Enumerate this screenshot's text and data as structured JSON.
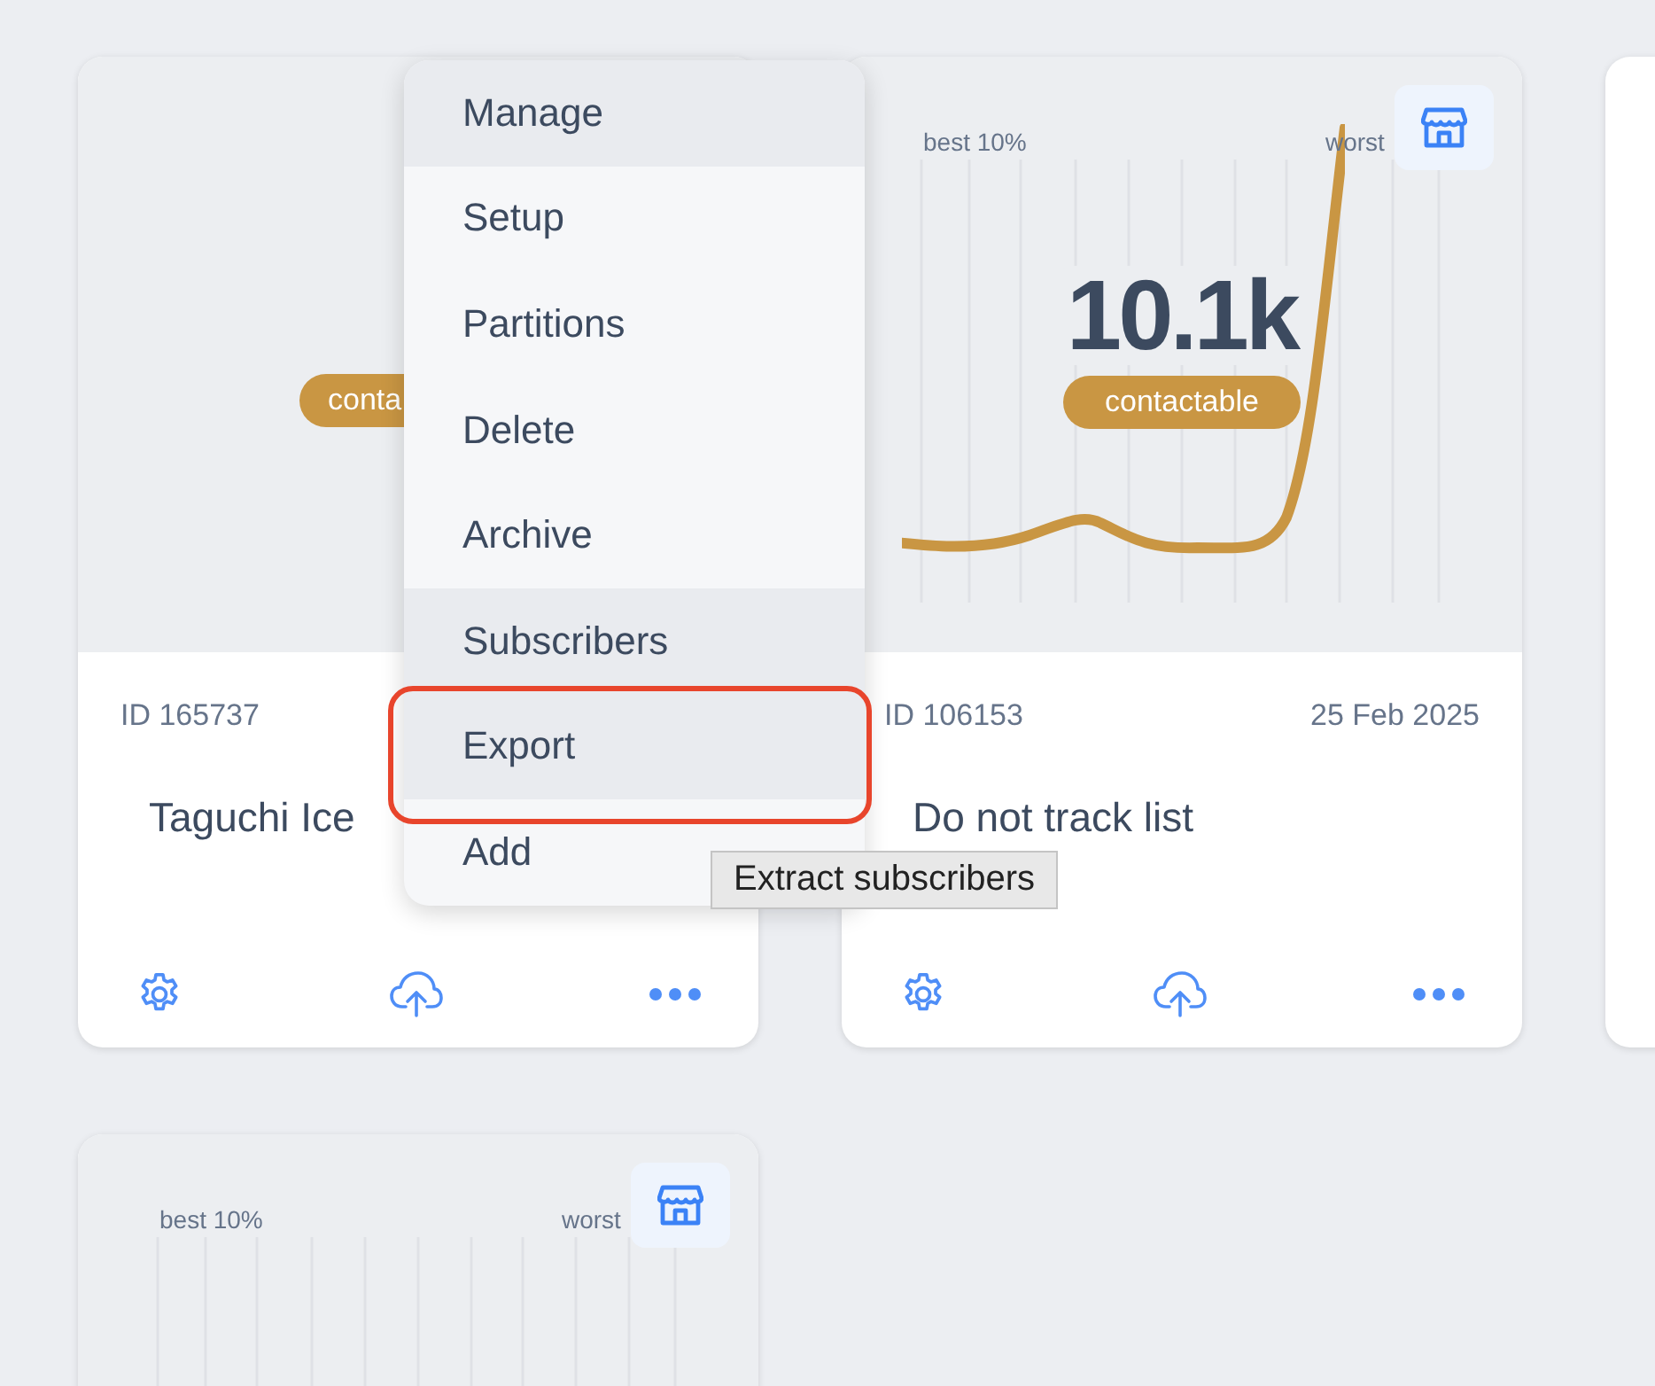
{
  "cards": [
    {
      "kind": "plain",
      "badge": "conta",
      "id": "ID 165737",
      "title": "Taguchi Ice"
    },
    {
      "kind": "trend",
      "best_label": "best 10%",
      "worst_label": "worst",
      "count": "10.1k",
      "badge": "contactable",
      "id": "ID 106153",
      "date": "25 Feb 2025",
      "title": "Do not track list"
    },
    {
      "kind": "blank"
    },
    {
      "kind": "grid",
      "best_label": "best 10%",
      "worst_label": "worst"
    }
  ],
  "menu": {
    "items": [
      {
        "label": "Manage",
        "highlighted": true,
        "outlined": false
      },
      {
        "label": "Setup",
        "highlighted": false,
        "outlined": false
      },
      {
        "label": "Partitions",
        "highlighted": false,
        "outlined": false
      },
      {
        "label": "Delete",
        "highlighted": false,
        "outlined": false
      },
      {
        "label": "Archive",
        "highlighted": false,
        "outlined": false
      },
      {
        "label": "Subscribers",
        "highlighted": true,
        "outlined": false
      },
      {
        "label": "Export",
        "highlighted": true,
        "outlined": true
      },
      {
        "label": "Add",
        "highlighted": false,
        "outlined": false
      }
    ]
  },
  "tooltip": "Extract subscribers"
}
